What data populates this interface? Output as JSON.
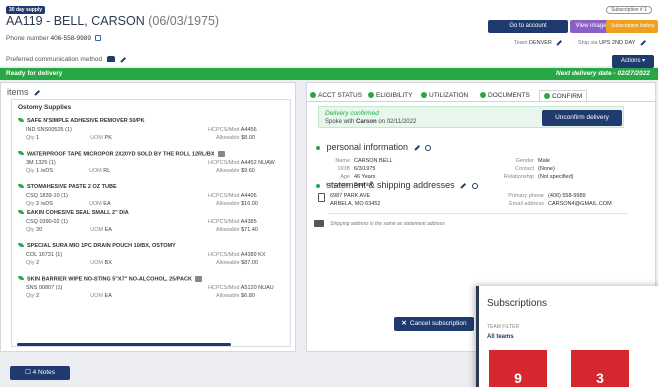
{
  "header": {
    "supply_badge": "30 day supply",
    "patient_name": "AA119 - BELL, CARSON",
    "patient_dob": "(06/03/1975)",
    "phone_label": "Phone number",
    "phone_value": "406-558-9989",
    "subscription_badge": "Subscription # 1",
    "go_to_account": "Go to account",
    "view_images": "View images",
    "subscription_history": "Subscription history",
    "team_label": "Team",
    "team_value": "DENVER",
    "ship_label": "Ship via",
    "ship_value": "UPS 2ND DAY",
    "pref_comm_label": "Preferred communication method",
    "actions_label": "Actions ▾"
  },
  "status_bar": {
    "left": "Ready for delivery",
    "right": "Next delivery date - 02/27/2022"
  },
  "items": {
    "title": "items",
    "category": "Ostomy Supplies",
    "list": [
      {
        "name": "SAFE N'SIMPLE ADHESIVE REMOVER 50/PK",
        "sku": "IND SNS00525  (1)",
        "qty": "1",
        "uom": "PK",
        "hcpcs": "A4456",
        "allowable": "$8.00",
        "cart": false
      },
      {
        "name": "WATERPROOF TAPE MICROPOR 2X20YD SOLD BY THE ROLL  12RL/BX",
        "sku": "3M 1325  (1)",
        "qty": "1 /eDS",
        "uom": "RL",
        "hcpcs": "A4452 NUAW",
        "allowable": "$9.60",
        "cart": true
      },
      {
        "name": "STOMAHESIVE PASTE 2 OZ TUBE",
        "sku": "CSQ 1839-10  (1)",
        "qty": "2 /eDS",
        "uom": "EA",
        "hcpcs": "A4406",
        "allowable": "$16.00",
        "cart": false
      },
      {
        "name": "EAKIN COHESIVE SEAL SMALL 2\" DIA",
        "sku": "CSQ 0390-02  (1)",
        "qty": "20",
        "uom": "EA",
        "hcpcs": "A4385",
        "allowable": "$71.40",
        "cart": false
      },
      {
        "name": "SPECIAL SURA MIO 1PC DRAIN POUCH 10/BX, OSTOMY",
        "sku": "COL 16731  (1)",
        "qty": "2",
        "uom": "BX",
        "hcpcs": "A4389 KX",
        "allowable": "$87.00",
        "cart": false
      },
      {
        "name": "SKIN BARRIER WIPE NO-STING 5\"X7\" NO-ALCOHOL, 25/PACK",
        "sku": "SNS 00807  (1)",
        "qty": "2",
        "uom": "EA",
        "hcpcs": "A5120 NUAU",
        "allowable": "$6.80",
        "cart": true
      }
    ],
    "qty_label": "Qty",
    "uom_label": "UOM",
    "hcpcs_label": "HCPCS/Mod",
    "allowable_label": "Allowable"
  },
  "tabs": [
    {
      "label": "ACCT STATUS"
    },
    {
      "label": "ELIGIBILITY"
    },
    {
      "label": "UTILIZATION"
    },
    {
      "label": "DOCUMENTS"
    },
    {
      "label": "CONFIRM"
    }
  ],
  "confirm": {
    "status": "Delivery confirmed",
    "spoke_prefix": "Spoke with",
    "spoke_name": "Carson",
    "spoke_suffix": "on 02/11/2022",
    "unconfirm_button": "Unconfirm delivery"
  },
  "personal": {
    "title": "personal information",
    "name_label": "Name",
    "name_value": "CARSON BELL",
    "dob_label": "DOB",
    "dob_value": "6/3/1975",
    "age_label": "Age",
    "age_value": "46 Years",
    "lang_label": "Language",
    "lang_value": "Spanish",
    "gender_label": "Gender",
    "gender_value": "Male",
    "contact_label": "Contact",
    "contact_value": "(None)",
    "relationship_label": "Relationship",
    "relationship_value": "(Not specified)"
  },
  "address": {
    "title": "statement & shipping addresses",
    "line1": "6987 PARK AVE",
    "line2": "ARBELA, MO 63452",
    "primary_phone_label": "Primary phone",
    "primary_phone_value": "(406) 558-9989",
    "email_label": "Email address",
    "email_value": "CARSON4@GMAIL.COM",
    "ship_note": "Shipping address is the same as statement address"
  },
  "cancel_subscription": "Cancel subscription",
  "notes_button": "4 Notes",
  "subscriptions_panel": {
    "title": "Subscriptions",
    "team_filter": "TEAM FILTER",
    "all_teams": "All teams",
    "tiles": [
      "9",
      "3"
    ]
  }
}
